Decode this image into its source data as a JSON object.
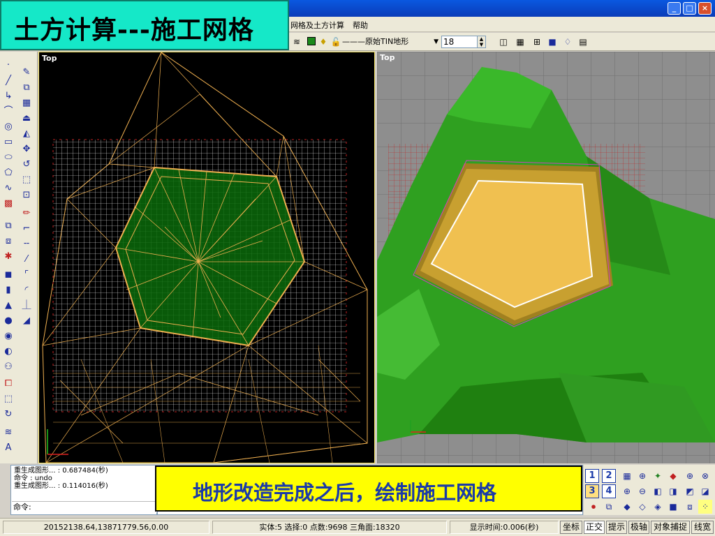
{
  "banner": {
    "title": "土方计算---施工网格"
  },
  "caption": {
    "text": "地形改造完成之后，绘制施工网格"
  },
  "menu": {
    "items": [
      "网格及土方计算",
      "帮助"
    ]
  },
  "toolbar": {
    "layer_name": "———原始TIN地形",
    "layer_color": "#1a8a1a",
    "lineweight_value": "18"
  },
  "viewports": {
    "left": {
      "label": "Top"
    },
    "right": {
      "label": "Top"
    }
  },
  "command": {
    "lines": [
      "重生成图形... : 0.687484(秒)",
      "命令 : undo",
      "重生成图形... : 0.114016(秒)"
    ],
    "prompt": "命令:"
  },
  "status": {
    "coords": "20152138.64,13871779.56,0.00",
    "stats": "实体:5 选择:0 点数:9698 三角面:18320",
    "display_time": "显示时间:0.006(秒)",
    "buttons": [
      "坐标",
      "正交",
      "提示",
      "极轴",
      "对象捕捉",
      "线宽"
    ]
  },
  "viewport_tabs": {
    "labels": [
      "1",
      "2",
      "3",
      "4"
    ]
  },
  "colors": {
    "mesh_wire": "#f0b050",
    "terrain_green": "#2fa020",
    "pad_fill": "#f0c050",
    "grid_red": "#c02020"
  }
}
